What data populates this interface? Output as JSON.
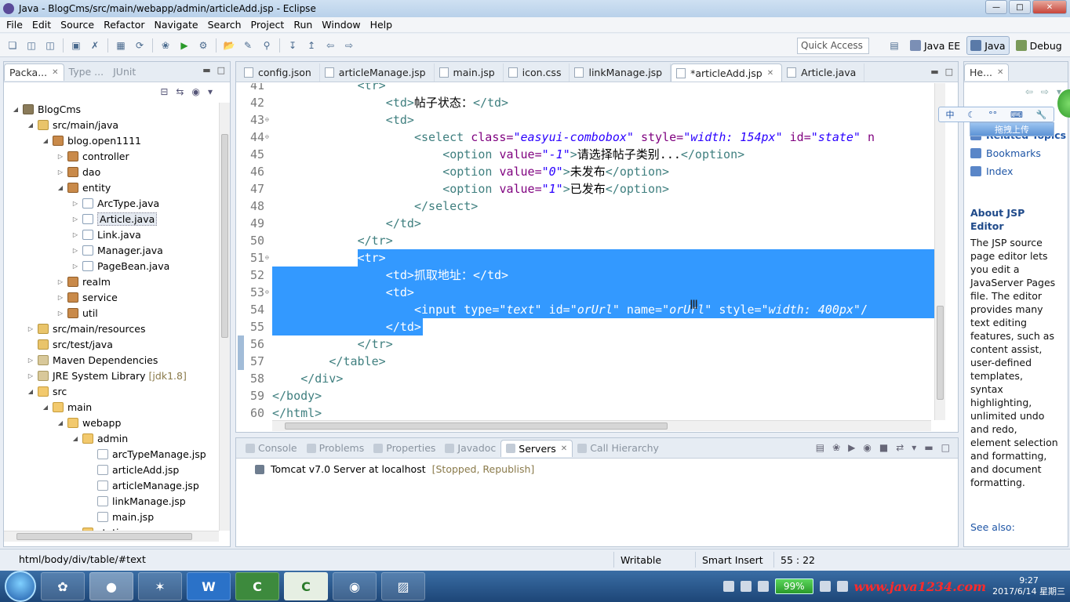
{
  "window": {
    "title": "Java - BlogCms/src/main/webapp/admin/articleAdd.jsp - Eclipse"
  },
  "menu": [
    "File",
    "Edit",
    "Source",
    "Refactor",
    "Navigate",
    "Search",
    "Project",
    "Run",
    "Window",
    "Help"
  ],
  "toolbar": {
    "quick_access": "Quick Access",
    "perspectives": [
      "Java EE",
      "Java",
      "Debug"
    ]
  },
  "left_pane": {
    "tabs": [
      "Packa...",
      "Type ...",
      "JUnit"
    ],
    "tree": [
      {
        "label": "BlogCms",
        "depth": 0,
        "icon": "proj",
        "twisty": "open"
      },
      {
        "label": "src/main/java",
        "depth": 1,
        "icon": "srcf",
        "twisty": "open"
      },
      {
        "label": "blog.open1111",
        "depth": 2,
        "icon": "pkg",
        "twisty": "open"
      },
      {
        "label": "controller",
        "depth": 3,
        "icon": "pkg",
        "twisty": "closed"
      },
      {
        "label": "dao",
        "depth": 3,
        "icon": "pkg",
        "twisty": "closed"
      },
      {
        "label": "entity",
        "depth": 3,
        "icon": "pkg",
        "twisty": "open"
      },
      {
        "label": "ArcType.java",
        "depth": 4,
        "icon": "java",
        "twisty": "closed"
      },
      {
        "label": "Article.java",
        "depth": 4,
        "icon": "java",
        "twisty": "closed",
        "selected": true
      },
      {
        "label": "Link.java",
        "depth": 4,
        "icon": "java",
        "twisty": "closed"
      },
      {
        "label": "Manager.java",
        "depth": 4,
        "icon": "java",
        "twisty": "closed"
      },
      {
        "label": "PageBean.java",
        "depth": 4,
        "icon": "java",
        "twisty": "closed"
      },
      {
        "label": "realm",
        "depth": 3,
        "icon": "pkg",
        "twisty": "closed"
      },
      {
        "label": "service",
        "depth": 3,
        "icon": "pkg",
        "twisty": "closed"
      },
      {
        "label": "util",
        "depth": 3,
        "icon": "pkg",
        "twisty": "closed"
      },
      {
        "label": "src/main/resources",
        "depth": 1,
        "icon": "srcf",
        "twisty": "closed"
      },
      {
        "label": "src/test/java",
        "depth": 1,
        "icon": "srcf",
        "twisty": "none"
      },
      {
        "label": "Maven Dependencies",
        "depth": 1,
        "icon": "lib",
        "twisty": "closed"
      },
      {
        "label": "JRE System Library",
        "extra": "[jdk1.8]",
        "depth": 1,
        "icon": "lib",
        "twisty": "closed"
      },
      {
        "label": "src",
        "depth": 1,
        "icon": "fold",
        "twisty": "open"
      },
      {
        "label": "main",
        "depth": 2,
        "icon": "fold",
        "twisty": "open"
      },
      {
        "label": "webapp",
        "depth": 3,
        "icon": "fold",
        "twisty": "open"
      },
      {
        "label": "admin",
        "depth": 4,
        "icon": "fold",
        "twisty": "open"
      },
      {
        "label": "arcTypeManage.jsp",
        "depth": 5,
        "icon": "jsp",
        "twisty": "none"
      },
      {
        "label": "articleAdd.jsp",
        "depth": 5,
        "icon": "jsp",
        "twisty": "none"
      },
      {
        "label": "articleManage.jsp",
        "depth": 5,
        "icon": "jsp",
        "twisty": "none"
      },
      {
        "label": "linkManage.jsp",
        "depth": 5,
        "icon": "jsp",
        "twisty": "none"
      },
      {
        "label": "main.jsp",
        "depth": 5,
        "icon": "jsp",
        "twisty": "none"
      },
      {
        "label": "static",
        "depth": 4,
        "icon": "fold",
        "twisty": "open"
      }
    ]
  },
  "editor": {
    "tabs": [
      {
        "label": "config.json"
      },
      {
        "label": "articleManage.jsp"
      },
      {
        "label": "main.jsp"
      },
      {
        "label": "icon.css"
      },
      {
        "label": "linkManage.jsp"
      },
      {
        "label": "*articleAdd.jsp",
        "active": true
      },
      {
        "label": "Article.java"
      }
    ],
    "lines": [
      {
        "n": "41",
        "indent": 3,
        "tokens": [
          [
            "tag",
            "<tr>"
          ]
        ]
      },
      {
        "n": "42",
        "indent": 4,
        "tokens": [
          [
            "tag",
            "<td>"
          ],
          [
            "txt",
            "帖子状态："
          ],
          [
            "tag",
            "</td>"
          ]
        ]
      },
      {
        "n": "43",
        "indent": 4,
        "fold": true,
        "tokens": [
          [
            "tag",
            "<td>"
          ]
        ]
      },
      {
        "n": "44",
        "indent": 5,
        "fold": true,
        "tokens": [
          [
            "tag",
            "<select "
          ],
          [
            "attr",
            "class="
          ],
          [
            "str",
            "\"easyui-combobox\""
          ],
          [
            "attr",
            " style="
          ],
          [
            "str",
            "\"width: 154px\""
          ],
          [
            "attr",
            " id="
          ],
          [
            "str",
            "\"state\""
          ],
          [
            "attr",
            " n"
          ]
        ]
      },
      {
        "n": "45",
        "indent": 6,
        "tokens": [
          [
            "tag",
            "<option "
          ],
          [
            "attr",
            "value="
          ],
          [
            "str",
            "\"-1\""
          ],
          [
            "tag",
            ">"
          ],
          [
            "txt",
            "请选择帖子类别..."
          ],
          [
            "tag",
            "</option>"
          ]
        ]
      },
      {
        "n": "46",
        "indent": 6,
        "tokens": [
          [
            "tag",
            "<option "
          ],
          [
            "attr",
            "value="
          ],
          [
            "str",
            "\"0\""
          ],
          [
            "tag",
            ">"
          ],
          [
            "txt",
            "未发布"
          ],
          [
            "tag",
            "</option>"
          ]
        ]
      },
      {
        "n": "47",
        "indent": 6,
        "tokens": [
          [
            "tag",
            "<option "
          ],
          [
            "attr",
            "value="
          ],
          [
            "str",
            "\"1\""
          ],
          [
            "tag",
            ">"
          ],
          [
            "txt",
            "已发布"
          ],
          [
            "tag",
            "</option>"
          ]
        ]
      },
      {
        "n": "48",
        "indent": 5,
        "tokens": [
          [
            "tag",
            "</select>"
          ]
        ]
      },
      {
        "n": "49",
        "indent": 4,
        "tokens": [
          [
            "tag",
            "</td>"
          ]
        ]
      },
      {
        "n": "50",
        "indent": 3,
        "tokens": [
          [
            "tag",
            "</tr>"
          ]
        ]
      },
      {
        "n": "51",
        "indent": 3,
        "fold": true,
        "sel": "partial",
        "tokens": [
          [
            "tag",
            "<tr>"
          ]
        ]
      },
      {
        "n": "52",
        "indent": 4,
        "sel": "full",
        "tokens": [
          [
            "tag",
            "<td>"
          ],
          [
            "txt",
            "抓取地址："
          ],
          [
            "tag",
            "</td>"
          ]
        ]
      },
      {
        "n": "53",
        "indent": 4,
        "fold": true,
        "sel": "full",
        "tokens": [
          [
            "tag",
            "<td>"
          ]
        ]
      },
      {
        "n": "54",
        "indent": 5,
        "sel": "full",
        "tokens": [
          [
            "tag",
            "<input "
          ],
          [
            "attr",
            "type="
          ],
          [
            "str",
            "\"text\""
          ],
          [
            "attr",
            " id="
          ],
          [
            "str",
            "\"orUrl\""
          ],
          [
            "attr",
            " name="
          ],
          [
            "str",
            "\"orUrl\""
          ],
          [
            "attr",
            " style="
          ],
          [
            "str",
            "\"width: 400px\""
          ],
          [
            "tag",
            "/"
          ]
        ]
      },
      {
        "n": "55",
        "indent": 4,
        "sel": "end",
        "tokens": [
          [
            "tag",
            "</td>"
          ]
        ]
      },
      {
        "n": "56",
        "indent": 3,
        "change": true,
        "tokens": [
          [
            "tag",
            "</tr>"
          ]
        ]
      },
      {
        "n": "57",
        "indent": 2,
        "change": true,
        "tokens": [
          [
            "tag",
            "</table>"
          ]
        ]
      },
      {
        "n": "58",
        "indent": 1,
        "tokens": [
          [
            "tag",
            "</div>"
          ]
        ]
      },
      {
        "n": "59",
        "indent": 0,
        "tokens": [
          [
            "tag",
            "</body>"
          ]
        ]
      },
      {
        "n": "60",
        "indent": 0,
        "tokens": [
          [
            "tag",
            "</html>"
          ]
        ]
      }
    ]
  },
  "bottom_pane": {
    "tabs": [
      {
        "label": "Console"
      },
      {
        "label": "Problems"
      },
      {
        "label": "Properties"
      },
      {
        "label": "Javadoc"
      },
      {
        "label": "Servers",
        "active": true
      },
      {
        "label": "Call Hierarchy"
      }
    ],
    "server": {
      "name": "Tomcat v7.0 Server at localhost",
      "state": "[Stopped, Republish]"
    }
  },
  "help_pane": {
    "tab": "He...",
    "links": [
      "Related Topics",
      "Bookmarks",
      "Index"
    ],
    "title": "About JSP Editor",
    "body": "The JSP source page editor lets you edit a JavaServer Pages file. The editor provides many text editing features, such as content assist, user-defined templates, syntax highlighting, unlimited undo and redo, element selection and formatting, and document formatting.",
    "see_also": "See also:"
  },
  "ime": {
    "label_zh": "中",
    "upload": "拖拽上传"
  },
  "status": {
    "path": "html/body/div/table/#text",
    "writable": "Writable",
    "insert_mode": "Smart Insert",
    "position": "55 : 22"
  },
  "taskbar": {
    "battery": "99%",
    "watermark": "www.java1234.com",
    "time": "9:27",
    "date": "2017/6/14 星期三"
  }
}
